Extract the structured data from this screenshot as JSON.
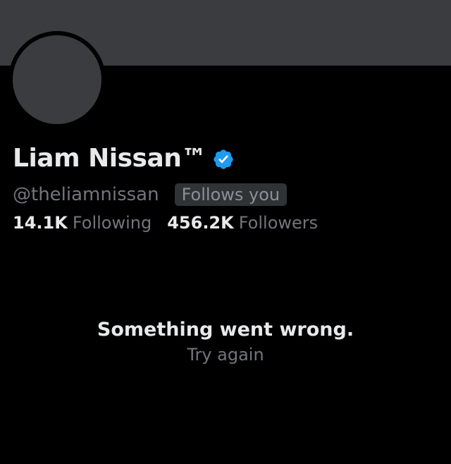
{
  "profile": {
    "display_name": "Liam Nissan™",
    "verified_icon": "verified-badge-icon",
    "handle": "@theliamnissan",
    "follows_you_label": "Follows you",
    "following_count": "14.1K",
    "following_label": "Following",
    "followers_count": "456.2K",
    "followers_label": "Followers"
  },
  "error": {
    "message": "Something went wrong.",
    "retry_label": "Try again"
  },
  "colors": {
    "background": "#000000",
    "banner": "#3b3c3f",
    "primary_text": "#e7e9ea",
    "secondary_text": "#71767b",
    "verified_blue": "#1d9bf0"
  }
}
